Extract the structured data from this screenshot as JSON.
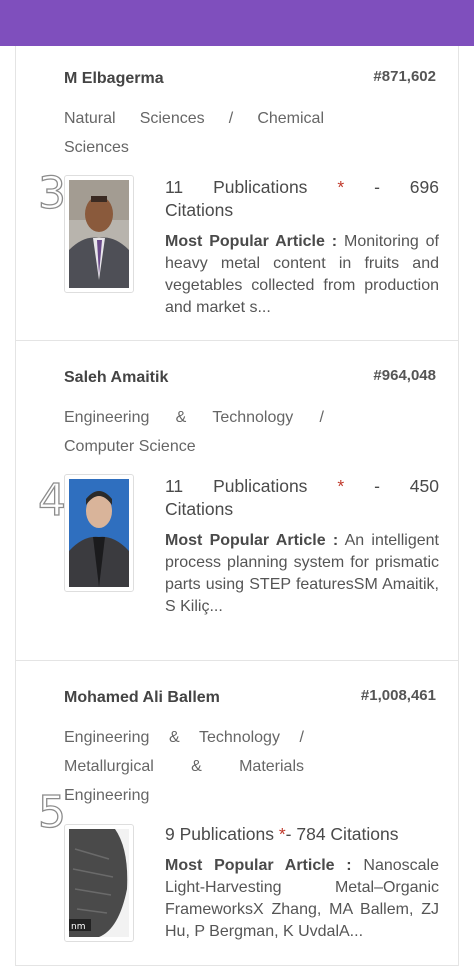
{
  "colors": {
    "header": "#7f4fbd",
    "star": "#c0392b"
  },
  "authors": [
    {
      "position": "3",
      "name": "M Elbagerma",
      "rank": "#871,602",
      "category": "Natural Sciences / Chemical Sciences",
      "publications": "11 Publications",
      "star": "*",
      "separator": "-",
      "citations": "696 Citations",
      "article_label": "Most Popular Article :",
      "article": "Monitoring of heavy metal content in fruits and vegetables collected from production and market s..."
    },
    {
      "position": "4",
      "name": "Saleh Amaitik",
      "rank": "#964,048",
      "category": "Engineering & Technology / Computer Science",
      "publications": "11 Publications",
      "star": "*",
      "separator": "-",
      "citations": "450 Citations",
      "article_label": "Most Popular Article :",
      "article": "An intelligent process planning system for prismatic parts using STEP featuresSM Amaitik, S Kiliç..."
    },
    {
      "position": "5",
      "name": "Mohamed Ali Ballem",
      "rank": "#1,008,461",
      "category": "Engineering & Technology / Metallurgical & Materials Engineering",
      "publications": "9 Publications",
      "star": "*",
      "separator": "-",
      "citations": "784 Citations",
      "article_label": "Most Popular Article :",
      "article": "Nanoscale Light-Harvesting Metal–Organic FrameworksX Zhang, MA Ballem, ZJ Hu, P Bergman, K UvdalA..."
    }
  ]
}
